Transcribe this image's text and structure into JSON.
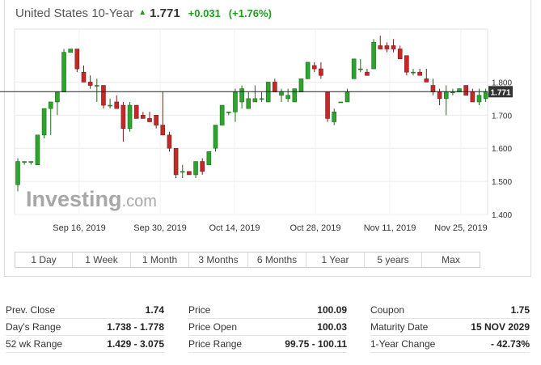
{
  "header": {
    "title": "United States 10-Year",
    "last": "1.771",
    "change": "+0.031",
    "change_pct": "(+1.76%)",
    "up_color": "#1e9e1e"
  },
  "chart_data": {
    "type": "candlestick",
    "x_labels": [
      "Sep 16, 2019",
      "Sep 30, 2019",
      "Oct 14, 2019",
      "Oct 28, 2019",
      "Nov 11, 2019",
      "Nov 25, 2019"
    ],
    "y_ticks": [
      "1.400",
      "1.500",
      "1.600",
      "1.700",
      "1.800"
    ],
    "ylim": [
      1.4,
      1.96
    ],
    "current_price": 1.771,
    "current_price_label": "1.771",
    "up_color": "#2ea32e",
    "down_color": "#c62828",
    "watermark": "Investing.com",
    "ohlc": [
      [
        1.49,
        1.57,
        1.47,
        1.56
      ],
      [
        1.56,
        1.56,
        1.55,
        1.56
      ],
      [
        1.56,
        1.56,
        1.55,
        1.56
      ],
      [
        1.55,
        1.64,
        1.55,
        1.64
      ],
      [
        1.64,
        1.72,
        1.63,
        1.72
      ],
      [
        1.72,
        1.74,
        1.64,
        1.74
      ],
      [
        1.74,
        1.77,
        1.7,
        1.77
      ],
      [
        1.77,
        1.9,
        1.77,
        1.89
      ],
      [
        1.89,
        1.9,
        1.89,
        1.9
      ],
      [
        1.9,
        1.9,
        1.83,
        1.84
      ],
      [
        1.83,
        1.85,
        1.8,
        1.8
      ],
      [
        1.8,
        1.82,
        1.78,
        1.79
      ],
      [
        1.79,
        1.81,
        1.74,
        1.79
      ],
      [
        1.79,
        1.79,
        1.72,
        1.73
      ],
      [
        1.73,
        1.75,
        1.72,
        1.73
      ],
      [
        1.74,
        1.76,
        1.72,
        1.72
      ],
      [
        1.73,
        1.74,
        1.62,
        1.66
      ],
      [
        1.66,
        1.74,
        1.65,
        1.73
      ],
      [
        1.73,
        1.73,
        1.69,
        1.69
      ],
      [
        1.7,
        1.71,
        1.69,
        1.69
      ],
      [
        1.69,
        1.71,
        1.68,
        1.68
      ],
      [
        1.7,
        1.7,
        1.66,
        1.67
      ],
      [
        1.67,
        1.77,
        1.64,
        1.64
      ],
      [
        1.64,
        1.65,
        1.59,
        1.6
      ],
      [
        1.6,
        1.6,
        1.51,
        1.52
      ],
      [
        1.53,
        1.55,
        1.51,
        1.53
      ],
      [
        1.53,
        1.53,
        1.52,
        1.52
      ],
      [
        1.52,
        1.56,
        1.51,
        1.56
      ],
      [
        1.56,
        1.57,
        1.52,
        1.53
      ],
      [
        1.55,
        1.59,
        1.55,
        1.59
      ],
      [
        1.6,
        1.67,
        1.59,
        1.67
      ],
      [
        1.67,
        1.73,
        1.67,
        1.73
      ],
      [
        1.71,
        1.71,
        1.7,
        1.71
      ],
      [
        1.71,
        1.78,
        1.68,
        1.77
      ],
      [
        1.74,
        1.79,
        1.72,
        1.78
      ],
      [
        1.72,
        1.77,
        1.72,
        1.75
      ],
      [
        1.74,
        1.79,
        1.74,
        1.75
      ],
      [
        1.75,
        1.77,
        1.74,
        1.75
      ],
      [
        1.74,
        1.8,
        1.74,
        1.8
      ],
      [
        1.8,
        1.81,
        1.77,
        1.77
      ],
      [
        1.76,
        1.78,
        1.74,
        1.77
      ],
      [
        1.75,
        1.78,
        1.74,
        1.76
      ],
      [
        1.74,
        1.78,
        1.74,
        1.78
      ],
      [
        1.77,
        1.81,
        1.77,
        1.81
      ],
      [
        1.81,
        1.86,
        1.81,
        1.86
      ],
      [
        1.85,
        1.86,
        1.83,
        1.84
      ],
      [
        1.84,
        1.86,
        1.81,
        1.82
      ],
      [
        1.77,
        1.77,
        1.68,
        1.69
      ],
      [
        1.68,
        1.72,
        1.67,
        1.71
      ],
      [
        1.74,
        1.74,
        1.74,
        1.74
      ],
      [
        1.74,
        1.78,
        1.74,
        1.77
      ],
      [
        1.81,
        1.87,
        1.81,
        1.87
      ],
      [
        1.84,
        1.87,
        1.83,
        1.84
      ],
      [
        1.83,
        1.84,
        1.82,
        1.82
      ],
      [
        1.84,
        1.93,
        1.84,
        1.92
      ],
      [
        1.91,
        1.94,
        1.9,
        1.9
      ],
      [
        1.91,
        1.92,
        1.89,
        1.9
      ],
      [
        1.91,
        1.93,
        1.89,
        1.9
      ],
      [
        1.9,
        1.91,
        1.87,
        1.87
      ],
      [
        1.88,
        1.88,
        1.82,
        1.83
      ],
      [
        1.83,
        1.84,
        1.82,
        1.83
      ],
      [
        1.83,
        1.84,
        1.82,
        1.82
      ],
      [
        1.81,
        1.84,
        1.8,
        1.8
      ],
      [
        1.79,
        1.81,
        1.76,
        1.77
      ],
      [
        1.77,
        1.78,
        1.73,
        1.75
      ],
      [
        1.75,
        1.79,
        1.7,
        1.77
      ],
      [
        1.77,
        1.78,
        1.76,
        1.77
      ],
      [
        1.77,
        1.78,
        1.77,
        1.78
      ],
      [
        1.79,
        1.79,
        1.76,
        1.76
      ],
      [
        1.77,
        1.78,
        1.74,
        1.74
      ],
      [
        1.74,
        1.78,
        1.73,
        1.76
      ],
      [
        1.75,
        1.78,
        1.74,
        1.77
      ]
    ]
  },
  "range_buttons": [
    "1 Day",
    "1 Week",
    "1 Month",
    "3 Months",
    "6 Months",
    "1 Year",
    "5 years",
    "Max"
  ],
  "stats": [
    [
      {
        "label": "Prev. Close",
        "value": "1.74"
      },
      {
        "label": "Day's Range",
        "value": "1.738 - 1.778"
      },
      {
        "label": "52 wk Range",
        "value": "1.429 - 3.075"
      }
    ],
    [
      {
        "label": "Price",
        "value": "100.09"
      },
      {
        "label": "Price Open",
        "value": "100.03"
      },
      {
        "label": "Price Range",
        "value": "99.75 - 100.11"
      }
    ],
    [
      {
        "label": "Coupon",
        "value": "1.75"
      },
      {
        "label": "Maturity Date",
        "value": "15 NOV 2029"
      },
      {
        "label": "1-Year Change",
        "value": "- 42.73%"
      }
    ]
  ]
}
